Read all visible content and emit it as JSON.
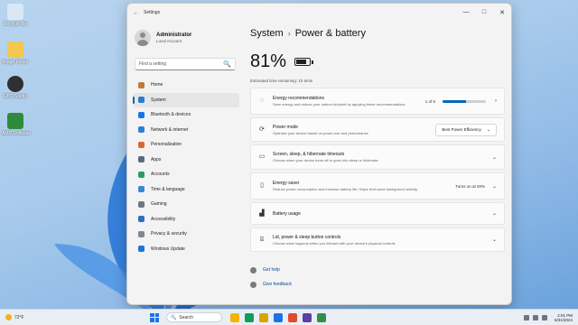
{
  "desktop": {
    "icons": [
      {
        "label": "Recycle Bin",
        "color": "#d9e8f7"
      },
      {
        "label": "Image Folder",
        "color": "#f2c94c"
      },
      {
        "label": "OBS Studio",
        "color": "#303030"
      },
      {
        "label": "AMD Software",
        "color": "#2e8b3a"
      }
    ]
  },
  "window": {
    "app_title": "Settings",
    "back": "←",
    "minimize": "—",
    "maximize": "□",
    "close": "✕"
  },
  "account": {
    "name": "Administrator",
    "sub": "Local Account"
  },
  "search": {
    "placeholder": "Find a setting",
    "icon": "🔍"
  },
  "sidebar": {
    "items": [
      {
        "label": "Home",
        "icon": "home-icon",
        "color": "#c07a3a"
      },
      {
        "label": "System",
        "icon": "system-icon",
        "color": "#2b7bd4",
        "active": true
      },
      {
        "label": "Bluetooth & devices",
        "icon": "bluetooth-icon",
        "color": "#1a73e8"
      },
      {
        "label": "Network & internet",
        "icon": "network-icon",
        "color": "#2f7fd6"
      },
      {
        "label": "Personalization",
        "icon": "personalization-icon",
        "color": "#d76b2e"
      },
      {
        "label": "Apps",
        "icon": "apps-icon",
        "color": "#5a6a7d"
      },
      {
        "label": "Accounts",
        "icon": "accounts-icon",
        "color": "#2e9c6a"
      },
      {
        "label": "Time & language",
        "icon": "time-icon",
        "color": "#3a86d0"
      },
      {
        "label": "Gaming",
        "icon": "gaming-icon",
        "color": "#6b7784"
      },
      {
        "label": "Accessibility",
        "icon": "accessibility-icon",
        "color": "#2a6fc2"
      },
      {
        "label": "Privacy & security",
        "icon": "privacy-icon",
        "color": "#7d8793"
      },
      {
        "label": "Windows Update",
        "icon": "update-icon",
        "color": "#1f74d6"
      }
    ]
  },
  "main": {
    "breadcrumb_parent": "System",
    "breadcrumb_sep": "›",
    "breadcrumb_current": "Power & battery",
    "battery_percent": "81%",
    "battery_level": 0.81,
    "estimate": "Estimated time remaining: 1h 6min",
    "cards": [
      {
        "title": "Energy recommendations",
        "desc": "Save energy and reduce your carbon footprint by applying these recommendations",
        "value": "1 of 6",
        "meter": 0.55,
        "chevron": "›"
      },
      {
        "title": "Power mode",
        "desc": "Optimize your device based on power use and performance",
        "dropdown": "Best Power Efficiency",
        "chevron": "⌄"
      },
      {
        "title": "Screen, sleep, & hibernate timeouts",
        "desc": "Choose when your device turns off or goes into sleep or hibernate",
        "chevron": "⌄"
      },
      {
        "title": "Energy saver",
        "desc": "Reduce power consumption and increase battery life. Helps limit some background activity.",
        "value": "Turns on at 20%",
        "chevron": "⌄"
      },
      {
        "title": "Battery usage",
        "desc": "",
        "chevron": "⌄"
      },
      {
        "title": "Lid, power & sleep button controls",
        "desc": "Choose what happens when you interact with your device's physical controls",
        "chevron": "⌄"
      }
    ]
  },
  "links": [
    {
      "label": "Get help"
    },
    {
      "label": "Give feedback"
    }
  ],
  "taskbar": {
    "weather": "72°F",
    "search_label": "Search",
    "apps": [
      "#f4b400",
      "#0f9d58",
      "#d9a400",
      "#1a73e8",
      "#e04b2b",
      "#5b3fa3",
      "#2f8f4f"
    ],
    "time": "2:01 PM",
    "date": "5/31/2024"
  }
}
